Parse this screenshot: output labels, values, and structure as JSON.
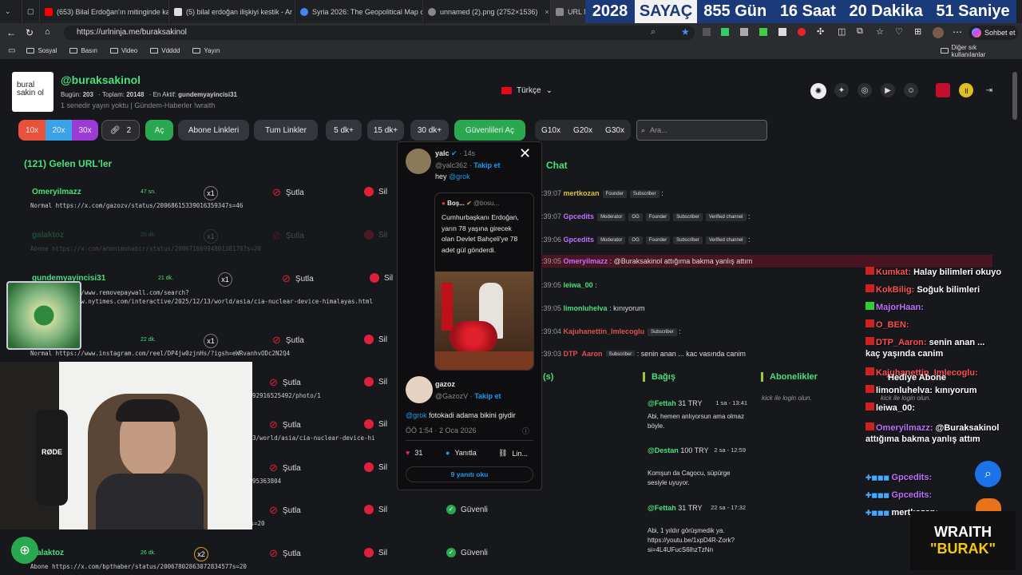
{
  "browser": {
    "tabs": [
      {
        "label": "(653) Bilal Erdoğan'ın mitinginde ka",
        "color": "#ff0000"
      },
      {
        "label": "(5) bilal erdoğan ilişkiyi kestik - Ar",
        "color": "#ffffff"
      },
      {
        "label": "Syria 2026: The Geopolitical Map o",
        "color": "#4285f4"
      },
      {
        "label": "unnamed (2).png (2752×1536)",
        "color": "#888888"
      },
      {
        "label": "URL N",
        "color": "#888888"
      }
    ],
    "url": "https://urlninja.me/buraksakinol",
    "bookmarks": [
      "Sosyal",
      "Basın",
      "Video",
      "Vdddd",
      "Yayın"
    ],
    "other_bookmarks": "Diğer sık kullanılanlar",
    "profile_button": "Sohbet et"
  },
  "countdown": {
    "year": "2028",
    "label": "SAYAÇ",
    "days": "855 Gün",
    "hours": "16 Saat",
    "minutes": "20 Dakika",
    "seconds": "51 Saniye"
  },
  "header": {
    "logo_text": "bural sakin ol",
    "username": "@buraksakinol",
    "today_label": "Bugün:",
    "today_value": "203",
    "total_label": "Toplam:",
    "total_value": "20148",
    "active_label": "En Aktif:",
    "active_value": "gundemyayincisi31",
    "subtitle": "1 senedir yayın yoktu | Gündem-Haberler !wraith",
    "language": "Türkçe"
  },
  "toolbar": {
    "zoom": [
      "10x",
      "20x",
      "30x"
    ],
    "link_count": "2",
    "open_label": "Aç",
    "subscriber_links": "Abone Linkleri",
    "all_links": "Tum Linkler",
    "minutes": [
      "5 dk+",
      "15 dk+",
      "30 dk+"
    ],
    "safe_open": "Güvenlileri Aç",
    "groups": [
      "G10x",
      "G20x",
      "G30x"
    ],
    "search_placeholder": "Ara..."
  },
  "urls": {
    "title": "(121) Gelen URL'ler",
    "rows": [
      {
        "user": "Omeryilmazz",
        "time": "47 sn.",
        "mult": "x1",
        "url": "Normal https://x.com/gazozv/status/20068615339016359347s=46",
        "faded": false,
        "safe": ""
      },
      {
        "user": "galaktoz",
        "time": "20 dk.",
        "mult": "x1",
        "url": "Abone https://x.com/anonimuhabir/status/2006716699480138179?s=20",
        "faded": true,
        "safe": ""
      },
      {
        "user": "gundemyayincisi31",
        "time": "21 dk.",
        "mult": "x1",
        "url": "Normal https://www.removepaywall.com/search?url=https://www.nytimes.com/interactive/2025/12/13/world/asia/cia-nuclear-device-himalayas.html",
        "faded": false,
        "safe": ""
      },
      {
        "user": "",
        "time": "22 dk.",
        "mult": "x1",
        "url": "Normal https://www.instagram.com/reel/DP4jw0zjnHs/?igsh=eWRvanhvODc2N2Q4",
        "faded": false,
        "safe": ""
      },
      {
        "user": "",
        "time": "",
        "mult": "",
        "url": "92916525492/photo/1",
        "faded": false,
        "safe": ""
      },
      {
        "user": "",
        "time": "",
        "mult": "",
        "url": "3/world/asia/cia-nuclear-device-hi",
        "faded": false,
        "safe": ""
      },
      {
        "user": "",
        "time": "",
        "mult": "",
        "url": "95363804",
        "faded": false,
        "safe": ""
      },
      {
        "user": "",
        "time": "",
        "mult": "",
        "url": "Abone https://x.com/bosunatikiama/status/2006790516517386272?s=20",
        "faded": false,
        "safe": "Güvenli"
      },
      {
        "user": "galaktoz",
        "time": "26 dk.",
        "mult": "x2",
        "url": "Abone https://x.com/bpthaber/status/20067802863072834577s=20",
        "faded": false,
        "safe": "Güvenli"
      }
    ],
    "shorten_label": "Şutla",
    "delete_label": "Sil"
  },
  "tweet": {
    "author": "yalc",
    "time": "14s",
    "handle": "@yalc362",
    "follow": "Takip et",
    "reply_prefix": "hey",
    "reply_mention": "@grok",
    "quote_author": "Boş...",
    "quote_handle": "@bosu...",
    "quote_text": "Cumhurbaşkanı Erdoğan, yarın 78 yaşına girecek olan Devlet Bahçeli'ye 78 adet gül gönderdi.",
    "author2": "gazoz",
    "handle2": "@GazozV",
    "follow2": "Takip et",
    "reply2_mention": "@grok",
    "reply2_text": "fotokadi adama bikini giydir",
    "timestamp": "ÖÖ 1:54 · 2 Oca 2026",
    "likes": "31",
    "reply_label": "Yanıtla",
    "link_label": "Lin...",
    "replies_link": "9 yanıtı oku"
  },
  "chat": {
    "title": "Chat",
    "messages": [
      {
        "time": ":39:07",
        "user": "mertkozan",
        "color": "#e0c040",
        "badges": [
          "Founder",
          "Subscriber"
        ],
        "text": ":"
      },
      {
        "time": ":39:07",
        "user": "Gpcedits",
        "color": "#c070ff",
        "badges": [
          "Moderator",
          "OG",
          "Founder",
          "Subscriber",
          "Verified channel"
        ],
        "text": ":"
      },
      {
        "time": ":39:06",
        "user": "Gpcedits",
        "color": "#c070ff",
        "badges": [
          "Moderator",
          "OG",
          "Founder",
          "Subscriber",
          "Verified channel"
        ],
        "text": ":"
      },
      {
        "time": ":39:05",
        "user": "Omeryilmazz",
        "color": "#c070ff",
        "badges": [],
        "text": ": @Buraksakinol attığıma bakma yanlış attım"
      },
      {
        "time": ":39:05",
        "user": "leiwa_00",
        "color": "#48e07a",
        "badges": [],
        "text": ":"
      },
      {
        "time": ":39:05",
        "user": "limonluhelva",
        "color": "#48e07a",
        "badges": [],
        "text": ": kınıyorum"
      },
      {
        "time": ":39:04",
        "user": "Kajuhanettin_Imlecoglu",
        "color": "#e05050",
        "badges": [
          "Subscriber"
        ],
        "text": ":"
      },
      {
        "time": ":39:03",
        "user": "DTP_Aaron",
        "color": "#e05050",
        "badges": [
          "Subscriber"
        ],
        "text": ": senin anan ... kaç yaşında canim"
      }
    ],
    "tab_left": "(s)",
    "tab_connect": "Bağış",
    "tab_subs": "Abonelikler",
    "subs_hint": "kick ile login olun.",
    "donations": [
      {
        "user": "@Fettah",
        "amount": "31 TRY",
        "time": "1 sa - 13:41",
        "text": "Abi, hemen anlıyorsun ama olmaz böyle."
      },
      {
        "user": "@Destan",
        "amount": "100 TRY",
        "time": "2 sa - 12:59",
        "text": "Komşun da Cagocu, süpürge sesiyle uyuyor."
      },
      {
        "user": "@Fettah",
        "amount": "31 TRY",
        "time": "22 sa - 17:32",
        "text": "Abi, 1 yıldır görüşmedik ya. https://youtu.be/1xpD4R-Zork?si=4L4UFucS6lhzTzNn"
      }
    ]
  },
  "overlay_chat": [
    {
      "user": "Kumkat:",
      "color": "#ff5050",
      "text": "Halay bilimleri okuyo"
    },
    {
      "user": "KokBilig:",
      "color": "#ff5050",
      "text": "Soğuk bilimleri"
    },
    {
      "user": "MajorHaan:",
      "color": "#c070ff",
      "text": ""
    },
    {
      "user": "O_BEN:",
      "color": "#ff5050",
      "text": ""
    },
    {
      "user": "DTP_Aaron:",
      "color": "#ff5050",
      "text": "senin anan ... kaç yaşında canim"
    },
    {
      "user": "Kajuhanettin_Imlecoglu:",
      "color": "#ff5050",
      "text": ""
    },
    {
      "user": "limonluhelva:",
      "color": "#ffffff",
      "text": "kınıyorum"
    },
    {
      "user": "leiwa_00:",
      "color": "#ffffff",
      "text": ""
    },
    {
      "user": "Omeryilmazz:",
      "color": "#c070ff",
      "text": "@Buraksakinol attığıma bakma yanlış attım"
    },
    {
      "user": "Gpcedits:",
      "color": "#c070ff",
      "text": ""
    },
    {
      "user": "Gpcedits:",
      "color": "#c070ff",
      "text": ""
    },
    {
      "user": "mertkozan:",
      "color": "#ffffff",
      "text": ""
    }
  ],
  "overlay_extra": {
    "hediye": "Hediye Abone",
    "kick_hint": "kick ile login olun."
  },
  "webcam": {
    "mic_label": "RØDE"
  },
  "brand": {
    "line1": "WRAITH",
    "line2": "\"BURAK\""
  },
  "colors": {
    "green": "#48e07a",
    "accent_green": "#2aa84f",
    "red": "#e0203a"
  }
}
